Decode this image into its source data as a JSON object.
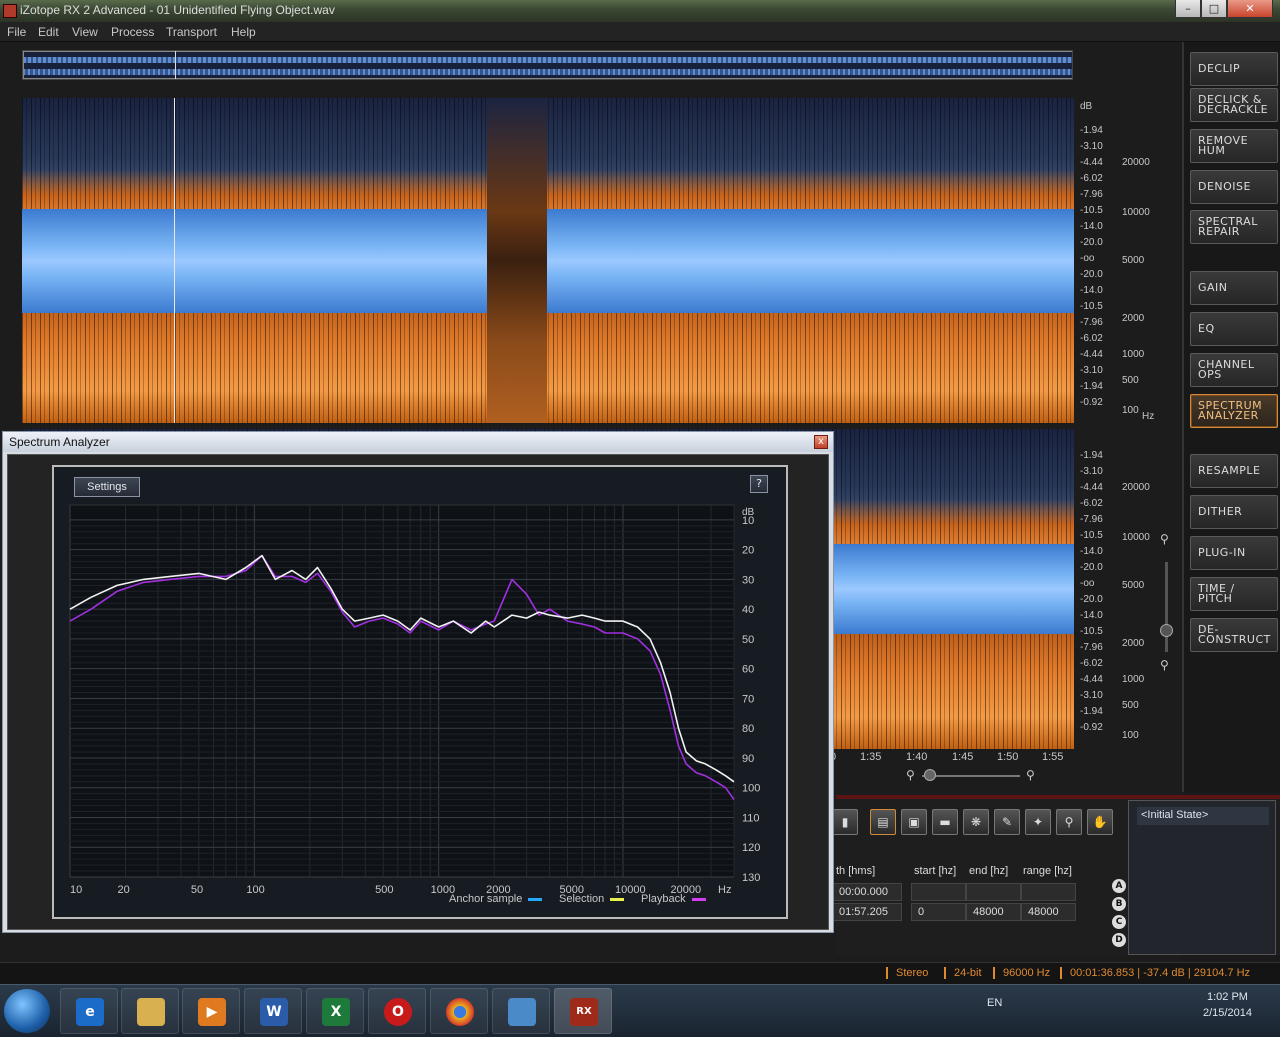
{
  "window": {
    "title": "iZotope RX 2 Advanced - 01 Unidentified Flying Object.wav"
  },
  "menu": [
    "File",
    "Edit",
    "View",
    "Process",
    "Transport",
    "Help"
  ],
  "db_scale": [
    "dB",
    "-1.94",
    "-3.10",
    "-4.44",
    "-6.02",
    "-7.96",
    "-10.5",
    "-14.0",
    "-20.0",
    "-oo",
    "-20.0",
    "-14.0",
    "-10.5",
    "-7.96",
    "-6.02",
    "-4.44",
    "-3.10",
    "-1.94",
    "-0.92"
  ],
  "hz_scale_top": [
    "20000",
    "10000",
    "5000",
    "2000",
    "1000",
    "500",
    "100"
  ],
  "hz_unit": "Hz",
  "time_axis": [
    "0",
    "1:35",
    "1:40",
    "1:45",
    "1:50",
    "1:55"
  ],
  "modules": [
    {
      "label": "DECLIP"
    },
    {
      "label": "DECLICK &\nDECRACKLE"
    },
    {
      "label": "REMOVE\nHUM"
    },
    {
      "label": "DENOISE"
    },
    {
      "label": "SPECTRAL\nREPAIR"
    },
    {
      "label": "GAIN"
    },
    {
      "label": "EQ"
    },
    {
      "label": "CHANNEL\nOPS"
    },
    {
      "label": "SPECTRUM\nANALYZER",
      "active": true
    },
    {
      "label": "RESAMPLE"
    },
    {
      "label": "DITHER"
    },
    {
      "label": "PLUG-IN"
    },
    {
      "label": "TIME /\nPITCH"
    },
    {
      "label": "DE-\nCONSTRUCT"
    }
  ],
  "selection": {
    "headers": [
      "th [hms]",
      "start [hz]",
      "end [hz]",
      "range [hz]"
    ],
    "row1": [
      "00:00.000",
      "",
      "",
      ""
    ],
    "row2": [
      "01:57.205",
      "0",
      "48000",
      "48000"
    ]
  },
  "abcd": [
    "A",
    "B",
    "C",
    "D"
  ],
  "history": {
    "item": "<Initial State>"
  },
  "status": {
    "channels": "Stereo",
    "bits": "24-bit",
    "rate": "96000 Hz",
    "cursor": "00:01:36.853 | -37.4 dB | 29104.7 Hz"
  },
  "analyzer": {
    "title": "Spectrum Analyzer",
    "settings_label": "Settings",
    "help_label": "?",
    "close_label": "x",
    "legend": {
      "anchor": "Anchor sample",
      "selection": "Selection",
      "playback": "Playback"
    },
    "colors": {
      "anchor": "#27a8ff",
      "selection": "#e8f050",
      "playback": "#d040f0",
      "white_trace": "#f2f2f2",
      "purple_trace": "#a030e0"
    }
  },
  "chart_data": {
    "type": "line",
    "title": "",
    "xlabel": "Hz",
    "ylabel": "dB",
    "x_scale": "log",
    "xlim": [
      10,
      40000
    ],
    "ylim": [
      130,
      5
    ],
    "y_ticks": [
      10,
      20,
      30,
      40,
      50,
      60,
      70,
      80,
      90,
      100,
      110,
      120,
      130
    ],
    "x_tick_labels": [
      "10",
      "20",
      "50",
      "100",
      "500",
      "1000",
      "2000",
      "5000",
      "10000",
      "20000"
    ],
    "x_tick_values": [
      10,
      20,
      50,
      100,
      500,
      1000,
      2000,
      5000,
      10000,
      20000
    ],
    "series": [
      {
        "name": "Selection",
        "color": "#f2f2f2",
        "x": [
          10,
          13,
          18,
          25,
          35,
          50,
          70,
          90,
          110,
          130,
          160,
          190,
          220,
          260,
          300,
          350,
          420,
          500,
          600,
          700,
          800,
          1000,
          1200,
          1500,
          1800,
          2000,
          2500,
          3000,
          3500,
          4000,
          5000,
          6000,
          7000,
          8000,
          10000,
          12000,
          14000,
          16000,
          18000,
          20000,
          22000,
          25000,
          28000,
          32000,
          36000,
          40000
        ],
        "y": [
          40,
          36,
          32,
          30,
          29,
          28,
          30,
          26,
          22,
          30,
          27,
          30,
          26,
          33,
          40,
          44,
          43,
          42,
          44,
          47,
          43,
          46,
          44,
          48,
          44,
          46,
          42,
          43,
          41,
          42,
          43,
          42,
          43,
          44,
          44,
          46,
          50,
          58,
          68,
          80,
          88,
          91,
          92,
          94,
          96,
          98
        ]
      },
      {
        "name": "Playback",
        "color": "#a030e0",
        "x": [
          10,
          13,
          18,
          25,
          35,
          50,
          70,
          90,
          110,
          130,
          160,
          190,
          220,
          260,
          300,
          350,
          420,
          500,
          600,
          700,
          800,
          1000,
          1200,
          1500,
          1800,
          2000,
          2500,
          3000,
          3500,
          4000,
          5000,
          6000,
          7000,
          8000,
          10000,
          12000,
          14000,
          16000,
          18000,
          20000,
          22000,
          25000,
          28000,
          32000,
          36000,
          40000
        ],
        "y": [
          44,
          40,
          34,
          31,
          30,
          29,
          29,
          27,
          22,
          29,
          29,
          31,
          28,
          34,
          41,
          46,
          44,
          43,
          45,
          48,
          44,
          47,
          44,
          47,
          45,
          44,
          30,
          35,
          42,
          40,
          44,
          45,
          46,
          48,
          48,
          50,
          54,
          62,
          74,
          86,
          92,
          95,
          96,
          98,
          100,
          104
        ]
      }
    ],
    "legend": [
      "Anchor sample",
      "Selection",
      "Playback"
    ],
    "legend_position": "bottom-right",
    "grid": true
  },
  "taskbar": {
    "lang": "EN",
    "time": "1:02 PM",
    "date": "2/15/2014"
  }
}
